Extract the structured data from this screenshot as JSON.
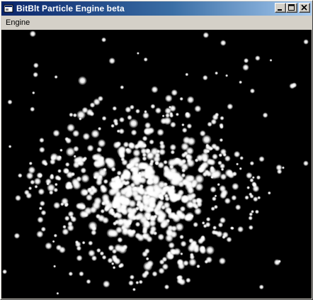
{
  "window": {
    "title": "BitBlt Particle Engine beta",
    "caption_buttons": [
      "minimize",
      "maximize",
      "close"
    ],
    "icon": "app-icon"
  },
  "menu": {
    "items": [
      {
        "label": "Engine"
      }
    ]
  },
  "colors": {
    "titlebar_start": "#0a246a",
    "titlebar_end": "#a6caf0",
    "canvas_background": "#000000",
    "particle": "#ffffff",
    "chrome": "#d4d0c8"
  }
}
